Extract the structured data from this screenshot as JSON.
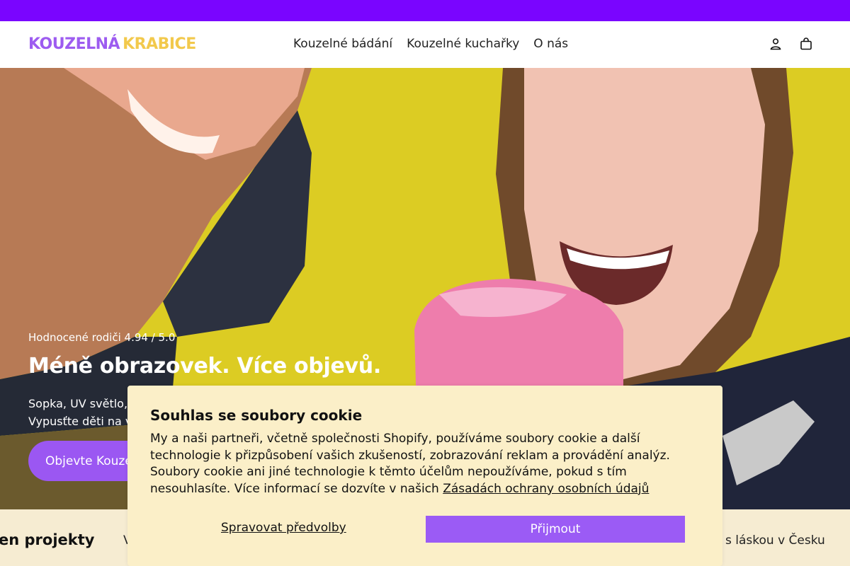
{
  "announcement": {
    "text": ""
  },
  "header": {
    "logo": {
      "word1": "KOUZELNÁ",
      "word2": "KRABICE"
    },
    "nav": [
      {
        "label": "Kouzelné bádání"
      },
      {
        "label": "Kouzelné kuchařky"
      },
      {
        "label": "O nás"
      }
    ],
    "icons": {
      "account": "account-icon",
      "cart": "cart-icon"
    }
  },
  "hero": {
    "rating": "Hodnocené rodiči 4.94 / 5.0",
    "title": "Méně obrazovek. Více objevů.",
    "text_line1": "Sopka, UV světlo,",
    "text_line2": "Vypusťte děti na ve",
    "cta": "Objevte Kouzelno"
  },
  "strip": {
    "left": "en projekty",
    "mid": "V",
    "right": "s láskou v Česku"
  },
  "cookie": {
    "title": "Souhlas se soubory cookie",
    "body": "My a naši partneři, včetně společnosti Shopify, používáme soubory cookie a další technologie k přizpůsobení vašich zkušeností, zobrazování reklam a provádění analýz. Soubory cookie ani jiné technologie k těmto účelům nepoužíváme, pokud s tím nesouhlasíte. Více informací se dozvíte v našich ",
    "link": "Zásadách ochrany osobních údajů",
    "manage": "Spravovat předvolby",
    "accept": "Přijmout"
  },
  "colors": {
    "announce_bar": "#7a05ff",
    "brand_purple": "#9b57f2",
    "brand_yellow": "#f2c94c",
    "cookie_bg": "#fbefc8",
    "strip_bg": "#f6ecd2"
  }
}
